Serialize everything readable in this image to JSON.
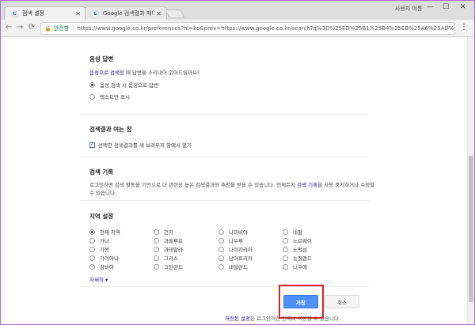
{
  "browser": {
    "tabs": [
      {
        "label": "검색 설정"
      },
      {
        "label": "Google 검색결과 페이지"
      }
    ],
    "user_label": "사용자 이름 ",
    "window_controls": {
      "minimize": "—",
      "maximize": "☐",
      "close": "✕"
    },
    "address": {
      "secure_label": "안전함",
      "url": "https://www.google.co.kr/preferences?hl=ko&prev=https://www.google.co.kr/search?q%3D%25ED%25B1%25B4%25EB%25A6%25AD%25E..."
    }
  },
  "settings": {
    "voice": {
      "title": "음성 답변",
      "desc_link": "음성으로 검색",
      "desc_rest": "할 때 답변을 소리내어 읽어드릴까요?",
      "options": [
        "음성 검색 시 음성으로 답변",
        "텍스트만 표시"
      ],
      "selected": 0
    },
    "results_window": {
      "title": "검색결과 여는 창",
      "checkbox_label": "선택한 검색결과를 새 브라우저 창에서 열기",
      "checked": true
    },
    "history": {
      "title": "검색 기록",
      "desc_part1": "로그인하면 검색 활동을 기반으로 더 관련성 높은 검색결과와 추천을 받을 수 있습니다. 언제든지 ",
      "desc_link": "검색 기록",
      "desc_part2": "을 사용 중지하거나 수정할 수 있습니다."
    },
    "region": {
      "title": "지역 설정",
      "columns": [
        [
          "현재 지역",
          "가나",
          "가봉",
          "가이아나",
          "감비아"
        ],
        [
          "건지",
          "과들루프",
          "과테말라",
          "그리스",
          "그린란드"
        ],
        [
          "나미비아",
          "나우루",
          "나이지리아",
          "남아프리카",
          "네덜란드"
        ],
        [
          "네팔",
          "노르웨이",
          "노퍽섬",
          "뉴질랜드",
          "니우에"
        ]
      ],
      "selected": "현재 지역",
      "more_label": "자세히 ▾"
    },
    "buttons": {
      "save": "저장",
      "cancel": "취소"
    },
    "footer": {
      "link": "저장된 설정",
      "rest": "은 로그인하면 언제나 사용할 수 있습니다."
    }
  }
}
